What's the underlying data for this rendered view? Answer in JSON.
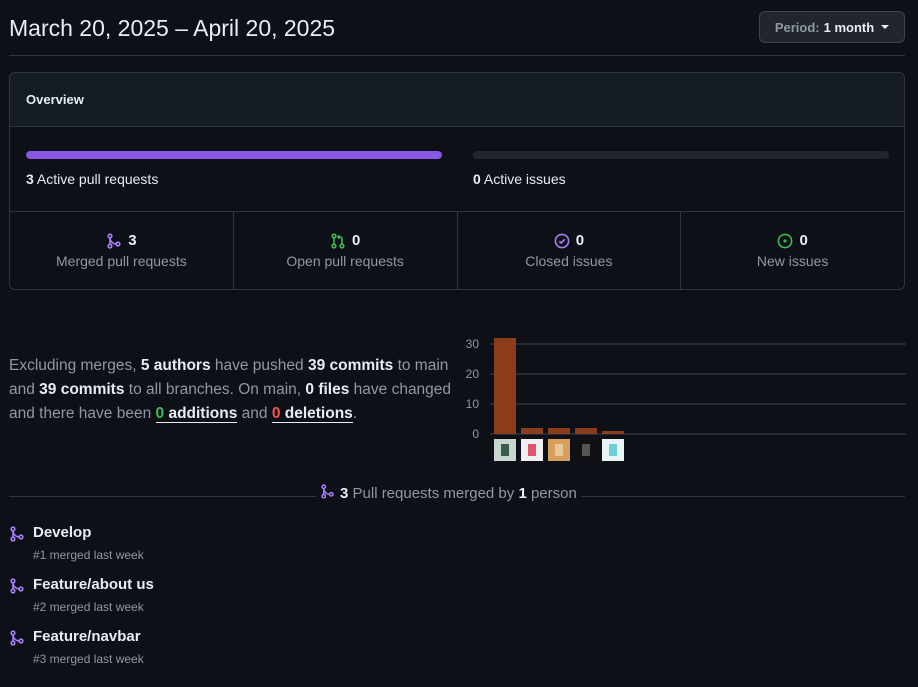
{
  "header": {
    "date_range": "March 20, 2025 – April 20, 2025",
    "period_label": "Period:",
    "period_value": "1 month"
  },
  "overview": {
    "title": "Overview",
    "pull_requests": {
      "count": "3",
      "label": "Active pull requests",
      "fill_fraction": 1.0,
      "color": "#8957e5"
    },
    "issues": {
      "count": "0",
      "label": "Active issues",
      "fill_fraction": 0.0
    },
    "stats": [
      {
        "icon": "git-merge-icon",
        "count": "3",
        "label": "Merged pull requests",
        "color": "#ab7df8"
      },
      {
        "icon": "git-pull-request-icon",
        "count": "0",
        "label": "Open pull requests",
        "color": "#3fb950"
      },
      {
        "icon": "issue-closed-icon",
        "count": "0",
        "label": "Closed issues",
        "color": "#ab7df8"
      },
      {
        "icon": "issue-opened-icon",
        "count": "0",
        "label": "New issues",
        "color": "#3fb950"
      }
    ]
  },
  "summary": {
    "t1": "Excluding merges, ",
    "authors": "5 authors",
    "t2": " have pushed ",
    "commits_main": "39 commits",
    "t3": " to main and ",
    "commits_all": "39 commits",
    "t4": " to all branches. On main, ",
    "files": "0 files",
    "t5": " have changed and there have been ",
    "additions_count": "0",
    "additions_word": " additions",
    "t6": " and ",
    "deletions_count": "0",
    "deletions_word": " deletions",
    "t7": "."
  },
  "chart_data": {
    "type": "bar",
    "categories": [
      "author-1",
      "author-2",
      "author-3",
      "author-4",
      "author-5"
    ],
    "values": [
      32,
      2,
      2,
      2,
      1
    ],
    "yticks": [
      0,
      10,
      20,
      30
    ],
    "ylim": [
      0,
      32
    ],
    "grid": true,
    "bar_color": "#8a3c1b",
    "avatar_icons": [
      "avatar-person-icon",
      "avatar-identicon-pink",
      "avatar-photo-icon",
      "avatar-dark-icon",
      "avatar-identicon-teal"
    ]
  },
  "merged_section": {
    "count": "3",
    "t1": " Pull requests merged by ",
    "people": "1",
    "t2": " person"
  },
  "pull_requests": [
    {
      "title": "Develop",
      "meta": "#1 merged last week"
    },
    {
      "title": "Feature/about us",
      "meta": "#2 merged last week"
    },
    {
      "title": "Feature/navbar",
      "meta": "#3 merged last week"
    }
  ]
}
